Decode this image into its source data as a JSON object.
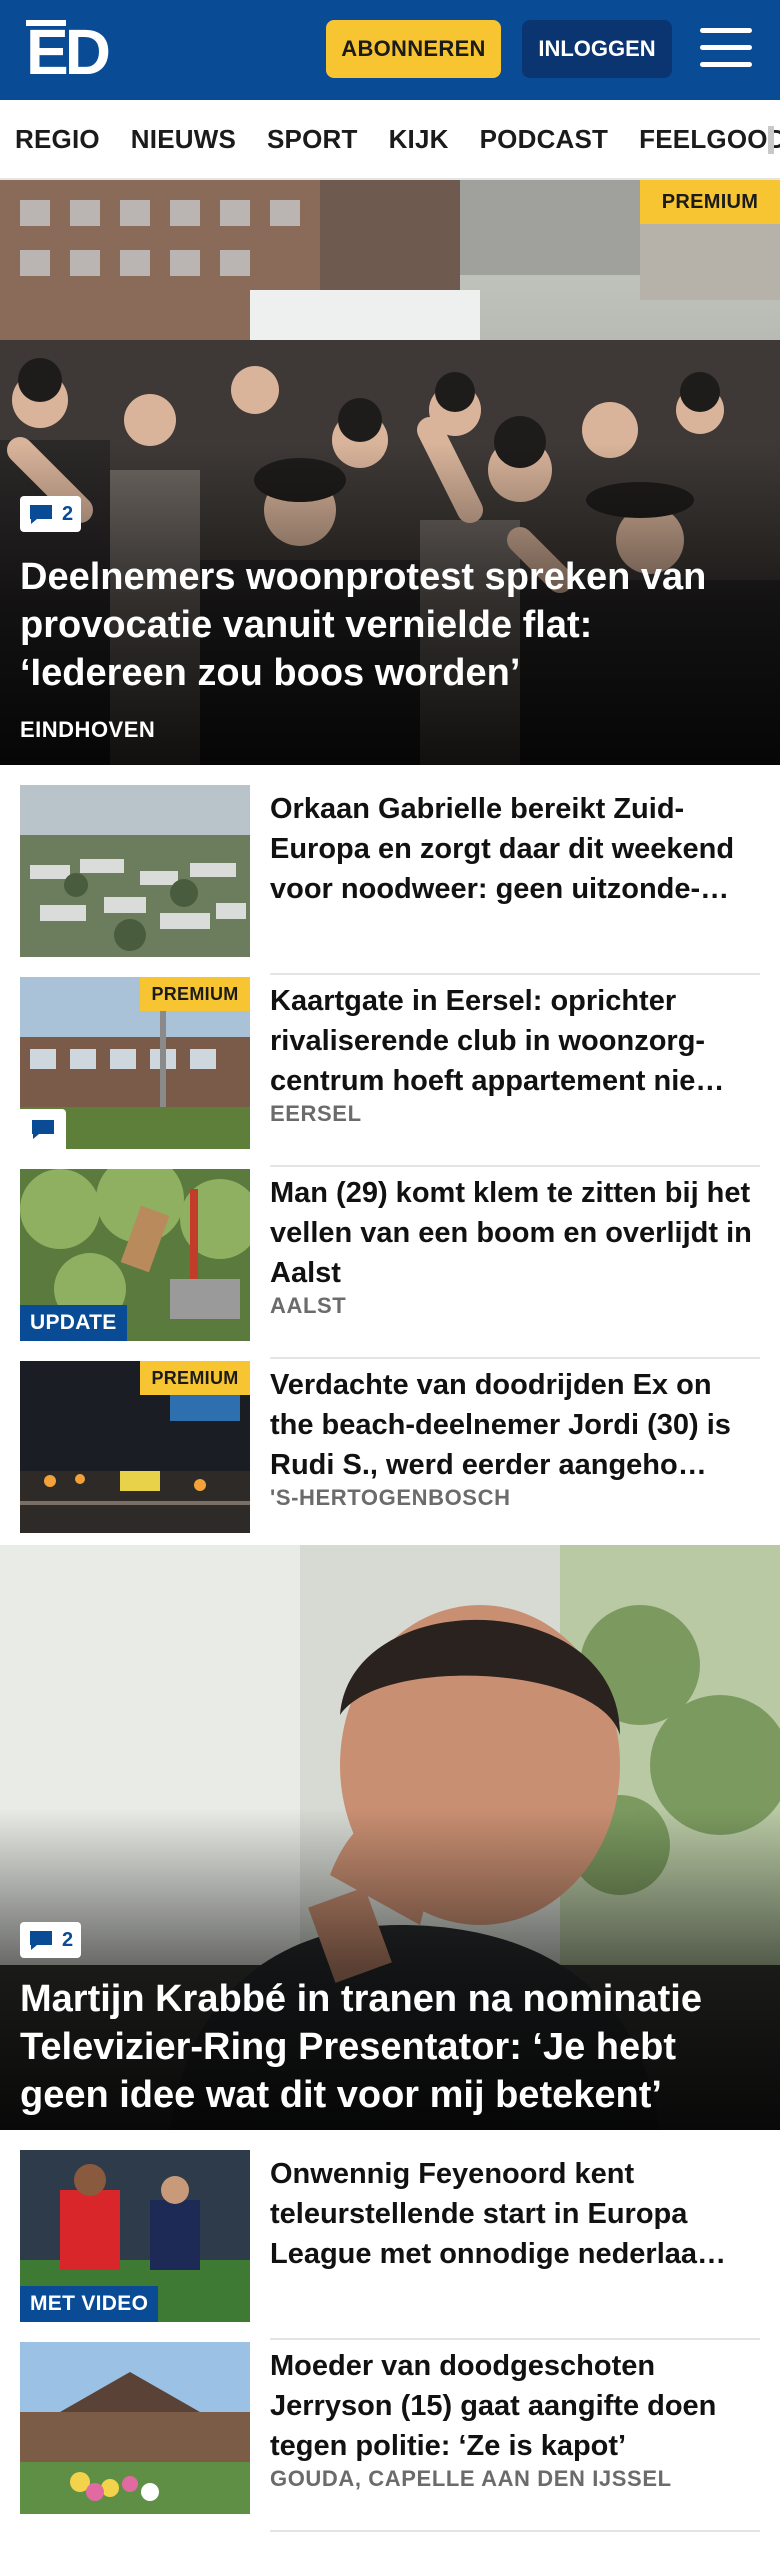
{
  "header": {
    "logo_text": "ED",
    "subscribe_label": "ABONNEREN",
    "login_label": "INLOGGEN"
  },
  "nav": {
    "items": [
      "REGIO",
      "NIEUWS",
      "SPORT",
      "KIJK",
      "PODCAST",
      "FEELGOOD"
    ]
  },
  "hero1": {
    "badge": "PREMIUM",
    "comments": "2",
    "title": "Deelnemers woonprotest spreken van provocatie vanuit vernielde flat: ‘Iedereen zou boos worden’",
    "location": "EINDHOVEN"
  },
  "list1": [
    {
      "title": "Orkaan Gabrielle bereikt Zuid-Europa en zorgt daar dit weekend voor noodweer: geen uitzonde-…",
      "location": ""
    },
    {
      "title": "Kaartgate in Eersel: oprichter rivaliserende club in woonzorg-centrum hoeft appartement nie…",
      "location": "EERSEL",
      "badge": "PREMIUM"
    },
    {
      "title": "Man (29) komt klem te zitten bij het vellen van een boom en overlijdt in Aalst",
      "location": "AALST",
      "tag": "UPDATE"
    },
    {
      "title": "Verdachte van doodrijden Ex on the beach-deelnemer Jordi (30) is Rudi S., werd eerder aangeho…",
      "location": "'S-HERTOGENBOSCH",
      "badge": "PREMIUM"
    }
  ],
  "hero2": {
    "comments": "2",
    "title": "Martijn Krabbé in tranen na nominatie Televizier-Ring Presentator: ‘Je hebt geen idee wat dit voor mij betekent’"
  },
  "list2": [
    {
      "title": "Onwennig Feyenoord kent teleurstellende start in Europa League met onnodige nederlaa…",
      "tag": "MET VIDEO"
    },
    {
      "title": "Moeder van doodgeschoten Jerryson (15) gaat aangifte doen tegen politie: ‘Ze is kapot’",
      "location": "GOUDA, CAPELLE AAN DEN IJSSEL"
    }
  ],
  "colors": {
    "brand_blue": "#0a4b95",
    "premium_yellow": "#f7c531",
    "login_navy": "#0b3570"
  }
}
